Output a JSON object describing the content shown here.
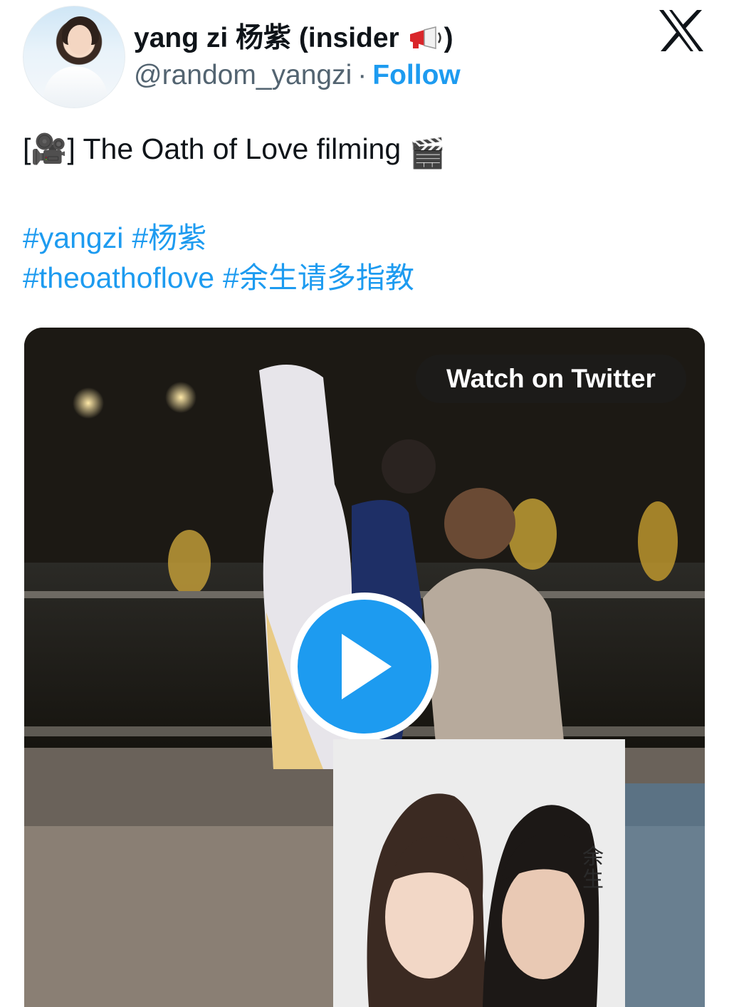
{
  "author": {
    "display_name": "yang zi 杨紫 (insider ",
    "display_name_close": ")",
    "handle": "@random_yangzi",
    "separator": "·",
    "follow_label": "Follow",
    "avatar_icon": "profile-photo",
    "badge_icon": "megaphone-icon"
  },
  "platform_icon": "x-logo-icon",
  "tweet": {
    "text_prefix": "[🎥] ",
    "text": "The Oath of Love filming ",
    "text_emoji": "🎬",
    "hashtags_line1": [
      "#yangzi",
      "#杨紫"
    ],
    "hashtags_line2": [
      "#theoathoflove",
      "#余生请多指教"
    ]
  },
  "media": {
    "watch_label": "Watch on Twitter",
    "play_icon": "play-icon",
    "poster_text": "余生"
  },
  "colors": {
    "link": "#1d9bf0",
    "secondary_text": "#536471",
    "primary_text": "#0f1419"
  }
}
